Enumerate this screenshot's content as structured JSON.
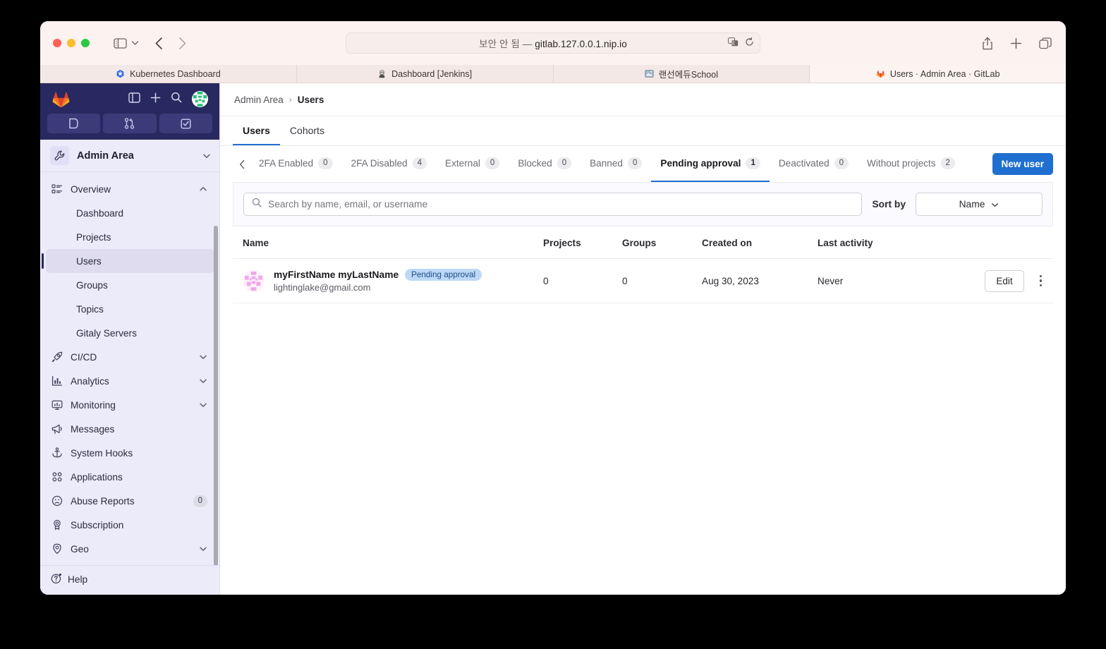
{
  "browser": {
    "url_prefix": "보안 안 됨",
    "url_dash": "—",
    "url": "gitlab.127.0.0.1.nip.io",
    "tabs": [
      {
        "label": "Kubernetes Dashboard",
        "icon": "kubernetes-icon",
        "active": false
      },
      {
        "label": "Dashboard [Jenkins]",
        "icon": "jenkins-icon",
        "active": false
      },
      {
        "label": "랜선에듀School",
        "icon": "school-icon",
        "active": false
      },
      {
        "label": "Users · Admin Area · GitLab",
        "icon": "gitlab-icon",
        "active": true
      }
    ],
    "icons": {
      "sidebar": "sidebar-toggle-icon",
      "back": "back-arrow-icon",
      "forward": "forward-arrow-icon",
      "shield": "privacy-shield-icon",
      "translate": "translate-icon",
      "reload": "reload-icon",
      "share": "share-icon",
      "newtab": "new-tab-icon",
      "tabs": "tab-overview-icon"
    }
  },
  "gitlab": {
    "sidebar": {
      "context_name": "Admin Area",
      "quick_actions": [
        "issues-icon",
        "merge-requests-icon",
        "todo-icon"
      ],
      "items": [
        {
          "label": "Overview",
          "icon": "overview-icon",
          "expandable": true,
          "expanded": true,
          "sub": false,
          "active": false
        },
        {
          "label": "Dashboard",
          "icon": "",
          "sub": true,
          "active": false
        },
        {
          "label": "Projects",
          "icon": "",
          "sub": true,
          "active": false
        },
        {
          "label": "Users",
          "icon": "",
          "sub": true,
          "active": true
        },
        {
          "label": "Groups",
          "icon": "",
          "sub": true,
          "active": false
        },
        {
          "label": "Topics",
          "icon": "",
          "sub": true,
          "active": false
        },
        {
          "label": "Gitaly Servers",
          "icon": "",
          "sub": true,
          "active": false
        },
        {
          "label": "CI/CD",
          "icon": "rocket-icon",
          "expandable": true,
          "sub": false,
          "active": false
        },
        {
          "label": "Analytics",
          "icon": "chart-icon",
          "expandable": true,
          "sub": false,
          "active": false
        },
        {
          "label": "Monitoring",
          "icon": "monitor-icon",
          "expandable": true,
          "sub": false,
          "active": false
        },
        {
          "label": "Messages",
          "icon": "megaphone-icon",
          "sub": false,
          "active": false
        },
        {
          "label": "System Hooks",
          "icon": "hook-icon",
          "sub": false,
          "active": false
        },
        {
          "label": "Applications",
          "icon": "applications-icon",
          "sub": false,
          "active": false
        },
        {
          "label": "Abuse Reports",
          "icon": "sad-face-icon",
          "sub": false,
          "active": false,
          "count": "0"
        },
        {
          "label": "Subscription",
          "icon": "license-icon",
          "sub": false,
          "active": false
        },
        {
          "label": "Geo",
          "icon": "location-icon",
          "expandable": true,
          "sub": false,
          "active": false
        }
      ],
      "help_label": "Help"
    },
    "breadcrumb": {
      "parent": "Admin Area",
      "separator": "›",
      "current": "Users"
    },
    "subtabs": [
      {
        "label": "Users",
        "active": true
      },
      {
        "label": "Cohorts",
        "active": false
      }
    ],
    "filter_tabs": [
      {
        "label": "2FA Enabled",
        "count": "0",
        "active": false
      },
      {
        "label": "2FA Disabled",
        "count": "4",
        "active": false
      },
      {
        "label": "External",
        "count": "0",
        "active": false
      },
      {
        "label": "Blocked",
        "count": "0",
        "active": false
      },
      {
        "label": "Banned",
        "count": "0",
        "active": false
      },
      {
        "label": "Pending approval",
        "count": "1",
        "active": true
      },
      {
        "label": "Deactivated",
        "count": "0",
        "active": false
      },
      {
        "label": "Without projects",
        "count": "2",
        "active": false
      }
    ],
    "new_user_label": "New user",
    "search": {
      "placeholder": "Search by name, email, or username",
      "value": ""
    },
    "sort": {
      "label": "Sort by",
      "value": "Name"
    },
    "table": {
      "columns": [
        "Name",
        "Projects",
        "Groups",
        "Created on",
        "Last activity",
        ""
      ],
      "rows": [
        {
          "name": "myFirstName myLastName",
          "badge": "Pending approval",
          "email": "lightinglake@gmail.com",
          "projects": "0",
          "groups": "0",
          "created_on": "Aug 30, 2023",
          "last_activity": "Never",
          "edit_label": "Edit"
        }
      ]
    },
    "colors": {
      "accent": "#1f6fd0",
      "sidebar_bg": "#ecebfa",
      "header_bg": "#292961",
      "badge_bg": "#bcd9f7"
    }
  }
}
